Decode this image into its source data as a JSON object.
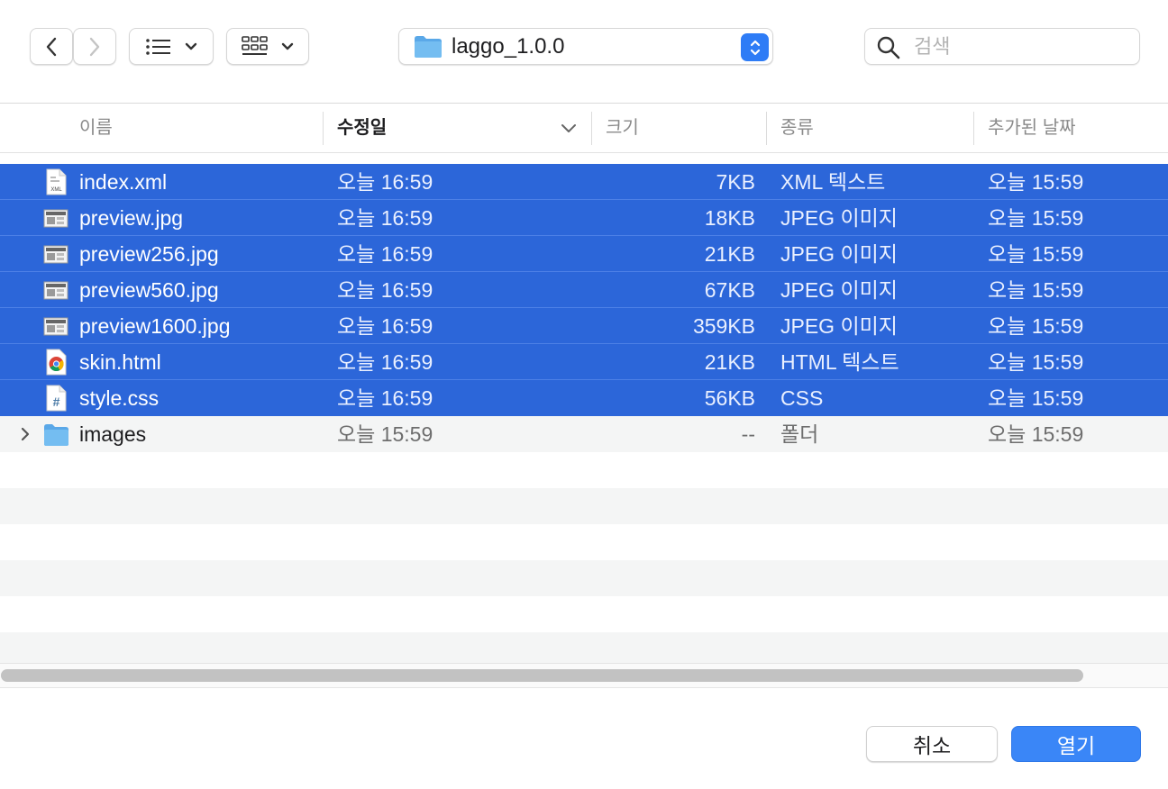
{
  "toolbar": {
    "path": "laggo_1.0.0",
    "search_placeholder": "검색"
  },
  "columns": {
    "name": "이름",
    "modified": "수정일",
    "size": "크기",
    "kind": "종류",
    "added": "추가된 날짜"
  },
  "files": [
    {
      "name": "index.xml",
      "modified": "오늘 16:59",
      "size": "7KB",
      "kind": "XML 텍스트",
      "added": "오늘 15:59",
      "icon": "xml-file-icon",
      "selected": true
    },
    {
      "name": "preview.jpg",
      "modified": "오늘 16:59",
      "size": "18KB",
      "kind": "JPEG 이미지",
      "added": "오늘 15:59",
      "icon": "image-file-icon",
      "selected": true
    },
    {
      "name": "preview256.jpg",
      "modified": "오늘 16:59",
      "size": "21KB",
      "kind": "JPEG 이미지",
      "added": "오늘 15:59",
      "icon": "image-file-icon",
      "selected": true
    },
    {
      "name": "preview560.jpg",
      "modified": "오늘 16:59",
      "size": "67KB",
      "kind": "JPEG 이미지",
      "added": "오늘 15:59",
      "icon": "image-file-icon",
      "selected": true
    },
    {
      "name": "preview1600.jpg",
      "modified": "오늘 16:59",
      "size": "359KB",
      "kind": "JPEG 이미지",
      "added": "오늘 15:59",
      "icon": "image-file-icon",
      "selected": true
    },
    {
      "name": "skin.html",
      "modified": "오늘 16:59",
      "size": "21KB",
      "kind": "HTML 텍스트",
      "added": "오늘 15:59",
      "icon": "chrome-html-file-icon",
      "selected": true
    },
    {
      "name": "style.css",
      "modified": "오늘 16:59",
      "size": "56KB",
      "kind": "CSS",
      "added": "오늘 15:59",
      "icon": "css-file-icon",
      "selected": true
    },
    {
      "name": "images",
      "modified": "오늘 15:59",
      "size": "--",
      "kind": "폴더",
      "added": "오늘 15:59",
      "icon": "folder-icon",
      "selected": false
    }
  ],
  "buttons": {
    "cancel": "취소",
    "open": "열기"
  },
  "colors": {
    "selection": "#2c66d9",
    "accent": "#3a86f7",
    "folder": "#6fb7ee"
  }
}
